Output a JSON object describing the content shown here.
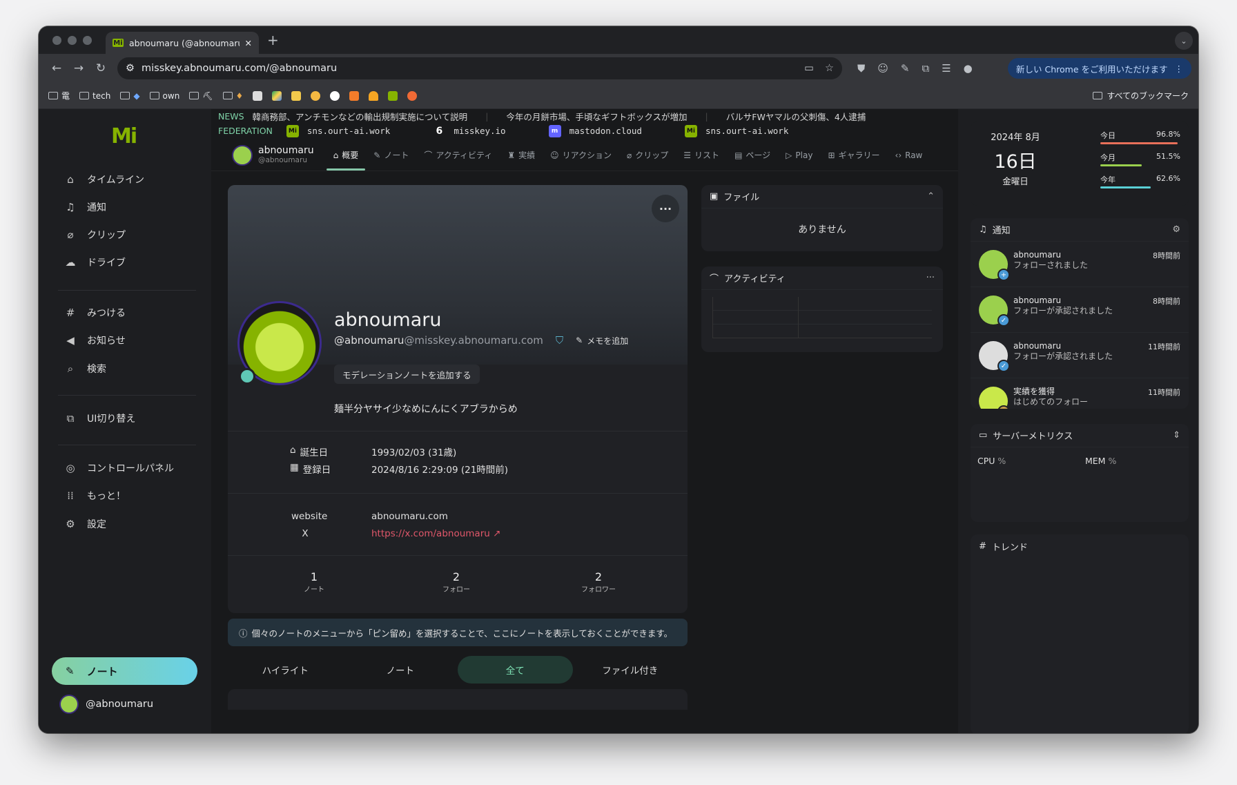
{
  "browser": {
    "tab_title": "abnoumaru (@abnoumaru) | n",
    "url": "misskey.abnoumaru.com/@abnoumaru",
    "promo": "新しい Chrome をご利用いただけます",
    "bookmarks": [
      "電",
      "tech",
      "own"
    ],
    "all_bookmarks": "すべてのブックマーク"
  },
  "sidebar": {
    "logo": "Mi",
    "items": [
      {
        "icon": "home-icon",
        "label": "タイムライン"
      },
      {
        "icon": "bell-icon",
        "label": "通知"
      },
      {
        "icon": "paperclip-icon",
        "label": "クリップ"
      },
      {
        "icon": "cloud-icon",
        "label": "ドライブ"
      },
      {
        "icon": "hash-icon",
        "label": "みつける"
      },
      {
        "icon": "megaphone-icon",
        "label": "お知らせ"
      },
      {
        "icon": "search-icon",
        "label": "検索"
      },
      {
        "icon": "switch-ui-icon",
        "label": "UI切り替え"
      },
      {
        "icon": "dashboard-icon",
        "label": "コントロールパネル"
      },
      {
        "icon": "grid-icon",
        "label": "もっと！"
      },
      {
        "icon": "gear-icon",
        "label": "設定"
      }
    ],
    "note_button": "ノート",
    "account": "@abnoumaru"
  },
  "ticker": {
    "news_label": "NEWS",
    "news": [
      "韓商務部、アンチモンなどの輸出規制実施について説明",
      "今年の月餅市場、手頃なギフトボックスが増加",
      "バルサFWヤマルの父刺傷、4人逮捕"
    ],
    "fed_label": "FEDERATION",
    "servers": [
      "sns.ourt-ai.work",
      "misskey.io",
      "mastodon.cloud",
      "sns.ourt-ai.work"
    ]
  },
  "user_header": {
    "name": "abnoumaru",
    "handle": "@abnoumaru",
    "tabs": [
      "概要",
      "ノート",
      "アクティビティ",
      "実績",
      "リアクション",
      "クリップ",
      "リスト",
      "ページ",
      "Play",
      "ギャラリー",
      "Raw"
    ]
  },
  "profile": {
    "name": "abnoumaru",
    "handle": "@abnoumaru",
    "host": "@misskey.abnoumaru.com",
    "memo": "メモを追加",
    "mod_note": "モデレーションノートを追加する",
    "bio": "麺半分ヤサイ少なめにんにくアブラからめ",
    "birthday_label": "誕生日",
    "birthday": "1993/02/03 (31歳)",
    "joined_label": "登録日",
    "joined": "2024/8/16 2:29:09 (21時間前)",
    "fields": [
      {
        "name": "website",
        "value": "abnoumaru.com"
      },
      {
        "name": "X",
        "value": "https://x.com/abnoumaru"
      }
    ],
    "stats": [
      {
        "value": "1",
        "label": "ノート"
      },
      {
        "value": "2",
        "label": "フォロー"
      },
      {
        "value": "2",
        "label": "フォロワー"
      }
    ]
  },
  "pin_info": "個々のノートのメニューから「ピン留め」を選択することで、ここにノートを表示しておくことができます。",
  "note_tabs": [
    "ハイライト",
    "ノート",
    "全て",
    "ファイル付き"
  ],
  "widgets": {
    "files": {
      "title": "ファイル",
      "empty": "ありません"
    },
    "activity": {
      "title": "アクティビティ"
    },
    "calendar": {
      "year_month": "2024年 8月",
      "day": "16日",
      "weekday": "金曜日",
      "bars": [
        {
          "label": "今日",
          "value": "96.8%",
          "fill": 0.968,
          "color": "#e8705a"
        },
        {
          "label": "今月",
          "value": "51.5%",
          "fill": 0.515,
          "color": "#9bd04d"
        },
        {
          "label": "今年",
          "value": "62.6%",
          "fill": 0.626,
          "color": "#5ad0d6"
        }
      ]
    },
    "notifications": {
      "title": "通知",
      "items": [
        {
          "user": "abnoumaru",
          "text": "フォローされました",
          "time": "8時間前",
          "badge": "+"
        },
        {
          "user": "abnoumaru",
          "text": "フォローが承認されました",
          "time": "8時間前",
          "badge": "✓"
        },
        {
          "user": "abnoumaru",
          "text": "フォローが承認されました",
          "time": "11時間前",
          "badge": "✓"
        },
        {
          "user": "実績を獲得",
          "text": "はじめてのフォロー",
          "time": "11時間前",
          "badge": "★"
        }
      ]
    },
    "metrics": {
      "title": "サーバーメトリクス",
      "cpu": "CPU",
      "mem": "MEM",
      "unit": "%"
    },
    "trends": {
      "title": "トレンド"
    }
  }
}
